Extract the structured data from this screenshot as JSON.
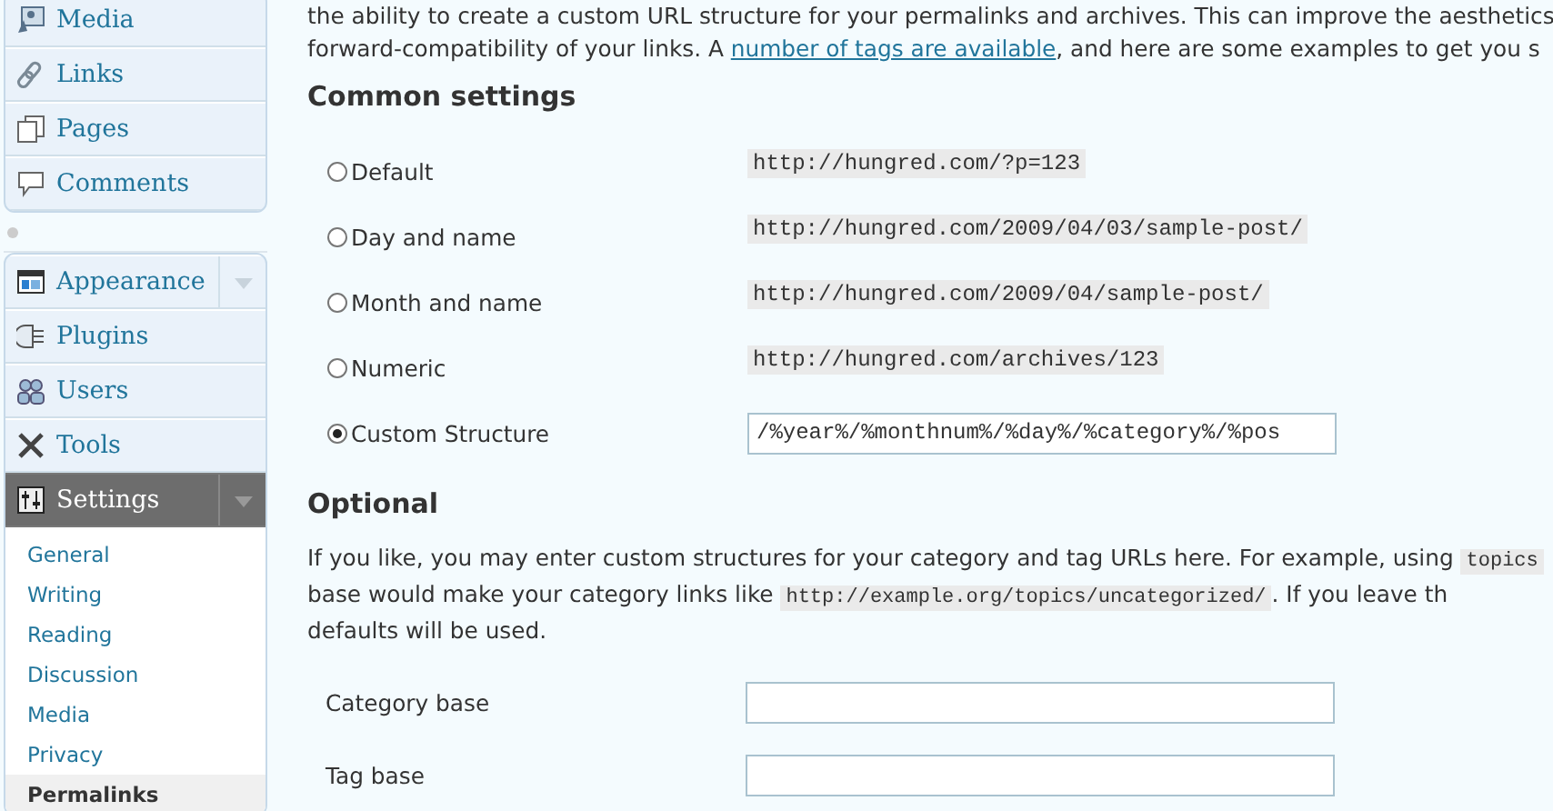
{
  "sidebar": {
    "groups": [
      {
        "items": [
          {
            "label": "Media",
            "selected": false,
            "has_toggle": false
          },
          {
            "label": "Links",
            "selected": false,
            "has_toggle": false
          },
          {
            "label": "Pages",
            "selected": false,
            "has_toggle": false
          },
          {
            "label": "Comments",
            "selected": false,
            "has_toggle": false
          }
        ]
      },
      {
        "items": [
          {
            "label": "Appearance",
            "selected": false,
            "has_toggle": true
          },
          {
            "label": "Plugins",
            "selected": false,
            "has_toggle": false
          },
          {
            "label": "Users",
            "selected": false,
            "has_toggle": false
          },
          {
            "label": "Tools",
            "selected": false,
            "has_toggle": false
          },
          {
            "label": "Settings",
            "selected": true,
            "has_toggle": true,
            "children": [
              {
                "label": "General",
                "selected": false
              },
              {
                "label": "Writing",
                "selected": false
              },
              {
                "label": "Reading",
                "selected": false
              },
              {
                "label": "Discussion",
                "selected": false
              },
              {
                "label": "Media",
                "selected": false
              },
              {
                "label": "Privacy",
                "selected": false
              },
              {
                "label": "Permalinks",
                "selected": true
              }
            ]
          }
        ]
      }
    ]
  },
  "intro": {
    "lines": [
      "the ability to create a custom URL structure for your permalinks and archives. This can improve the aesthetics"
    ],
    "line2_before": "forward-compatibility of your links. A ",
    "link": "number of tags are available",
    "line2_after": ", and here are some examples to get you s"
  },
  "common": {
    "heading": "Common settings",
    "options": [
      {
        "label": "Default",
        "selected": false,
        "kind": "example",
        "example": "http://hungred.com/?p=123"
      },
      {
        "label": "Day and name",
        "selected": false,
        "kind": "example",
        "example": "http://hungred.com/2009/04/03/sample-post/"
      },
      {
        "label": "Month and name",
        "selected": false,
        "kind": "example",
        "example": "http://hungred.com/2009/04/sample-post/"
      },
      {
        "label": "Numeric",
        "selected": false,
        "kind": "example",
        "example": "http://hungred.com/archives/123"
      },
      {
        "label": "Custom Structure",
        "selected": true,
        "kind": "input",
        "value": "/%year%/%monthnum%/%day%/%category%/%pos"
      }
    ]
  },
  "optional": {
    "heading": "Optional",
    "lines": [
      [
        {
          "text": "If you like, you may enter custom structures for your category and tag URLs here. For example, using "
        },
        {
          "code": "topics"
        }
      ],
      [
        {
          "text": "base would make your category links like "
        },
        {
          "code": "http://example.org/topics/uncategorized/"
        },
        {
          "text": ". If you leave th"
        }
      ],
      [
        {
          "text": "defaults will be used."
        }
      ]
    ],
    "fields": [
      {
        "label": "Category base"
      },
      {
        "label": "Tag base"
      }
    ]
  }
}
